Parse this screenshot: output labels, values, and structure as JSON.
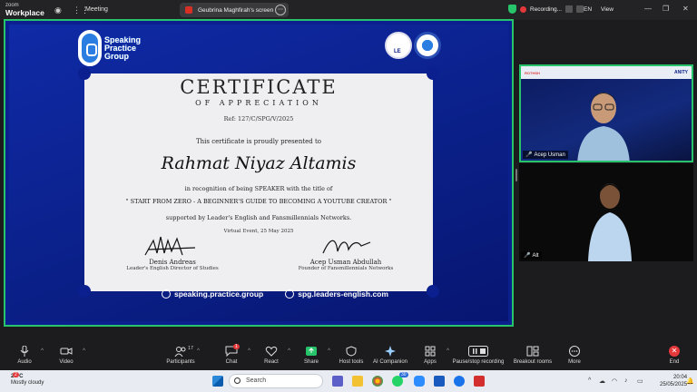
{
  "app": {
    "brand_top": "zoom",
    "brand_bottom": "Workplace",
    "meeting_label": "Meeting"
  },
  "share_pill": {
    "label": "Geubrina Maghfirah's screen"
  },
  "status": {
    "recording": "Recording...",
    "language": "EN",
    "view": "View"
  },
  "certificate": {
    "logo_text": [
      "Speaking",
      "Practice",
      "Group"
    ],
    "seal_tag": "LE",
    "title": "CERTIFICATE",
    "subtitle": "OF APPRECIATION",
    "ref": "Ref: 127/C/SPG/V/2025",
    "presented": "This certificate is proudly presented to",
    "recipient": "Rahmat Niyaz Altamis",
    "recognition": "in recognition of being SPEAKER with the title of",
    "topic": "\" START FROM ZERO - A BEGINNER'S GUIDE TO BECOMING A YOUTUBE CREATOR \"",
    "support": "supported by Leader's English and Fansmillennials Networks.",
    "event": "Virtual Event, 25 May 2025",
    "signers": [
      {
        "name": "Denis Andreas",
        "role": "Leader's English Director of Studies"
      },
      {
        "name": "Acep Usman Abdullah",
        "role": "Founder of Fansmillennials Networks"
      }
    ],
    "links": [
      "speaking.practice.group",
      "spg.leaders-english.com"
    ]
  },
  "participants": [
    {
      "name": "Acep Usman",
      "muted": true
    },
    {
      "name": "Alt",
      "muted": true
    }
  ],
  "toolbar": {
    "audio": "Audio",
    "video": "Video",
    "participants": "Participants",
    "participants_count": "17",
    "chat": "Chat",
    "chat_badge": "1",
    "react": "React",
    "share": "Share",
    "host_tools": "Host tools",
    "ai_companion": "AI Companion",
    "apps": "Apps",
    "pause_stop": "Pause/stop recording",
    "breakout": "Breakout rooms",
    "more": "More",
    "end": "End"
  },
  "taskbar": {
    "weather_temp": "24°C",
    "weather_desc": "Mostly cloudy",
    "weather_badge": "2",
    "search_placeholder": "Search",
    "whatsapp_badge": "30",
    "time": "20:04",
    "date": "25/05/2025"
  },
  "colors": {
    "accent_green": "#27c46b",
    "share_bg": "#0b1f8f",
    "end_red": "#e5383b"
  }
}
